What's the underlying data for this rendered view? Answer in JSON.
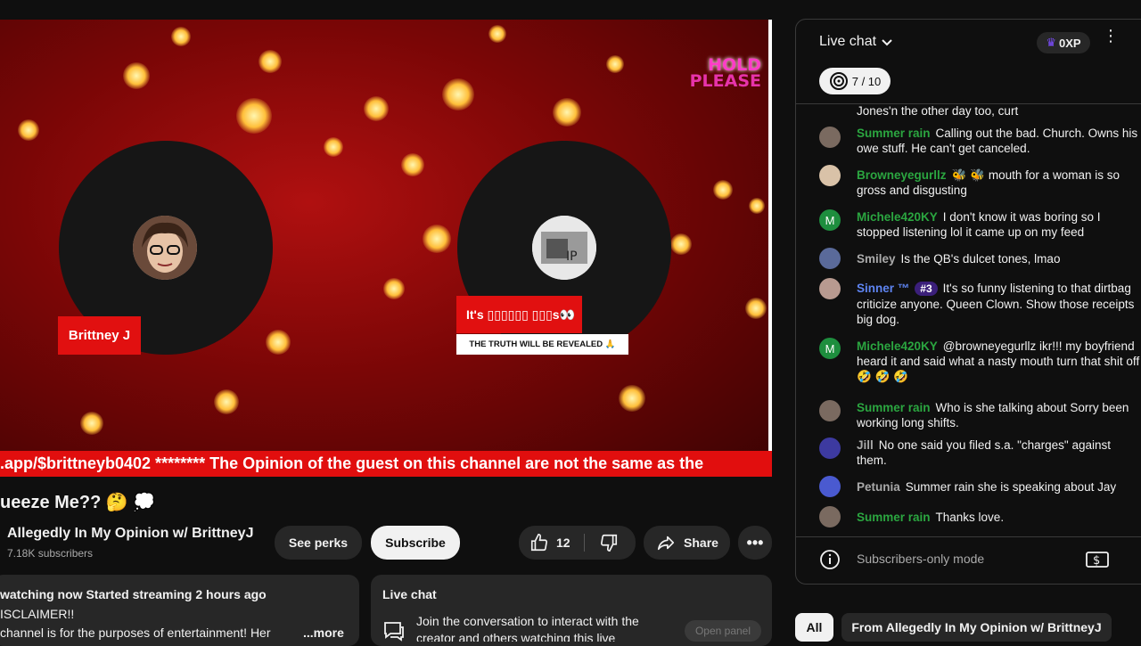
{
  "video": {
    "hold_line1": "HOLD",
    "hold_line2": "PLEASE",
    "host_name": "Brittney J",
    "guest_caption": "It's ▯▯▯▯▯▯ ▯▯▯s👀",
    "guest_subcaption": "THE TRUTH WILL BE REVEALED 🙏",
    "ticker": ".app/$brittneyb0402 ******** The Opinion of the guest on this channel are not the same as the"
  },
  "below": {
    "title": "ueeze Me?? 🤔 💭",
    "channel_name": "Allegedly In My Opinion w/ BrittneyJ",
    "subscribers": "7.18K subscribers",
    "see_perks": "See perks",
    "subscribe": "Subscribe",
    "likes": "12",
    "share": "Share"
  },
  "description": {
    "stats": "watching now  Started streaming 2 hours ago",
    "line2": "ISCLAIMER!!",
    "line3": " channel is for the purposes of entertainment!  Her",
    "more": "...more"
  },
  "live_chat_box": {
    "title": "Live chat",
    "text": "Join the conversation to interact with the creator and others watching this live",
    "open_panel": "Open panel"
  },
  "chat": {
    "header_title": "Live chat",
    "xp": "0XP",
    "progress": "7 / 10",
    "messages": [
      {
        "author": "",
        "text": "Jones'n the other day too, curt"
      },
      {
        "author": "Summer rain",
        "text": "Calling out the bad. Church. Owns his owe stuff. He can't get canceled."
      },
      {
        "author": "Browneyegurllz",
        "text": "mouth for a woman is so gross and disgusting"
      },
      {
        "author": "Michele420KY",
        "text": "I don't know it was boring so I stopped listening lol it came up on my feed"
      },
      {
        "author": "Smiley",
        "text": "Is the QB's dulcet tones, lmao"
      },
      {
        "author": "Sinner ™",
        "badge": "#3",
        "text": "It's so funny listening to that dirtbag criticize anyone. Queen Clown. Show those receipts big dog."
      },
      {
        "author": "Michele420KY",
        "text": "@browneyegurllz ikr!!! my boyfriend heard it and said what a nasty mouth turn that shit off 🤣 🤣 🤣"
      },
      {
        "author": "Summer rain",
        "text": "Who is she talking about Sorry been working long shifts."
      },
      {
        "author": "Jill",
        "text": "No one said you filed s.a. \"charges\" against them."
      },
      {
        "author": "Petunia",
        "text": "Summer rain she is speaking about Jay"
      },
      {
        "author": "Summer rain",
        "text": "Thanks love."
      }
    ],
    "input_placeholder": "Subscribers-only mode"
  },
  "chips": {
    "all": "All",
    "from_channel": "From Allegedly In My Opinion w/ BrittneyJ"
  },
  "colors": {
    "accent_red": "#e10e0e",
    "chat_green": "#2ba640"
  }
}
